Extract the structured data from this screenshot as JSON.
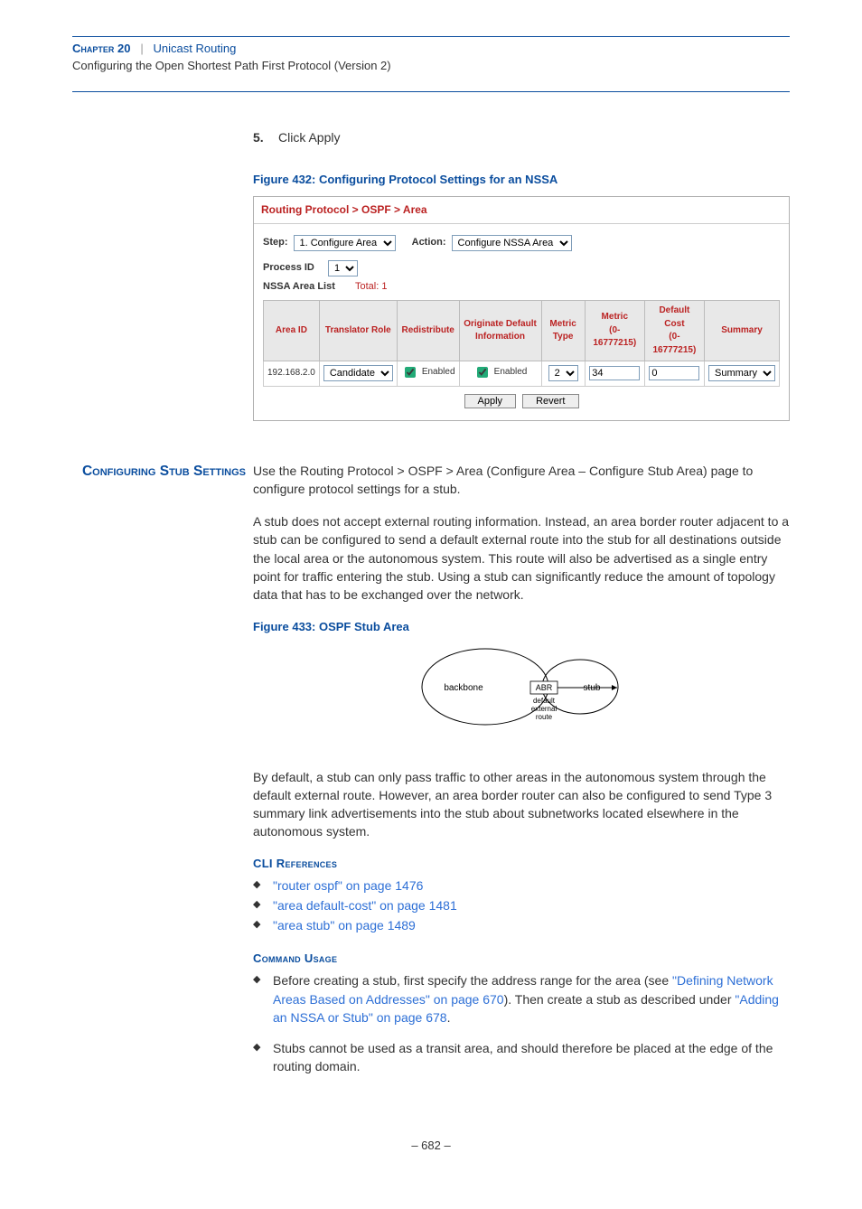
{
  "header": {
    "chapter": "Chapter 20",
    "divider": "|",
    "title": "Unicast Routing",
    "subtitle": "Configuring the Open Shortest Path First Protocol (Version 2)"
  },
  "step": {
    "num": "5.",
    "text": "Click Apply"
  },
  "figure432": {
    "caption": "Figure 432:  Configuring Protocol Settings for an NSSA",
    "breadcrumb": "Routing Protocol > OSPF > Area",
    "step_label": "Step:",
    "step_value": "1. Configure Area",
    "action_label": "Action:",
    "action_value": "Configure NSSA Area",
    "process_label": "Process ID",
    "process_value": "1",
    "list_label": "NSSA Area List",
    "total_label": "Total: 1",
    "headers": {
      "area_id": "Area ID",
      "translator": "Translator Role",
      "redistribute": "Redistribute",
      "originate": "Originate Default Information",
      "metric_type": "Metric Type",
      "metric": "Metric\n(0-16777215)",
      "default_cost": "Default Cost\n(0-16777215)",
      "summary": "Summary"
    },
    "row": {
      "area_id": "192.168.2.0",
      "translator": "Candidate",
      "redistribute": "Enabled",
      "originate": "Enabled",
      "metric_type": "2",
      "metric": "34",
      "default_cost": "0",
      "summary": "Summary"
    },
    "buttons": {
      "apply": "Apply",
      "revert": "Revert"
    }
  },
  "stub_section": {
    "heading": "Configuring Stub Settings",
    "intro": "Use the Routing Protocol > OSPF > Area (Configure Area – Configure Stub Area) page to configure protocol settings for a stub.",
    "para1": "A stub does not accept external routing information. Instead, an area border router adjacent to a stub can be configured to send a default external route into the stub for all destinations outside the local area or the autonomous system. This route will also be advertised as a single entry point for traffic entering the stub. Using a stub can significantly reduce the amount of topology data that has to be exchanged over the network.",
    "fig_caption": "Figure 433:   OSPF Stub Area",
    "diagram": {
      "backbone": "backbone",
      "abr": "ABR",
      "stub": "stub",
      "route": "default\nexternal\nroute"
    },
    "para2": "By default, a stub can only pass traffic to other areas in the autonomous system through the default external route. However, an area border router can also be configured to send Type 3 summary link advertisements into the stub about subnetworks located elsewhere in the autonomous system.",
    "cli_heading": "CLI References",
    "cli_refs": [
      "\"router ospf\" on page 1476",
      "\"area default-cost\" on page 1481",
      "\"area stub\" on page 1489"
    ],
    "cmd_heading": "Command Usage",
    "cmd1_pre": "Before creating a stub, first specify the address range for the area (see ",
    "cmd1_link1": "\"Defining Network Areas Based on Addresses\" on page 670",
    "cmd1_mid": "). Then create a stub as described under ",
    "cmd1_link2": "\"Adding an NSSA or Stub\" on page 678",
    "cmd1_end": ".",
    "cmd2": "Stubs cannot be used as a transit area, and should therefore be placed at the edge of the routing domain."
  },
  "page_number": "–  682  –"
}
